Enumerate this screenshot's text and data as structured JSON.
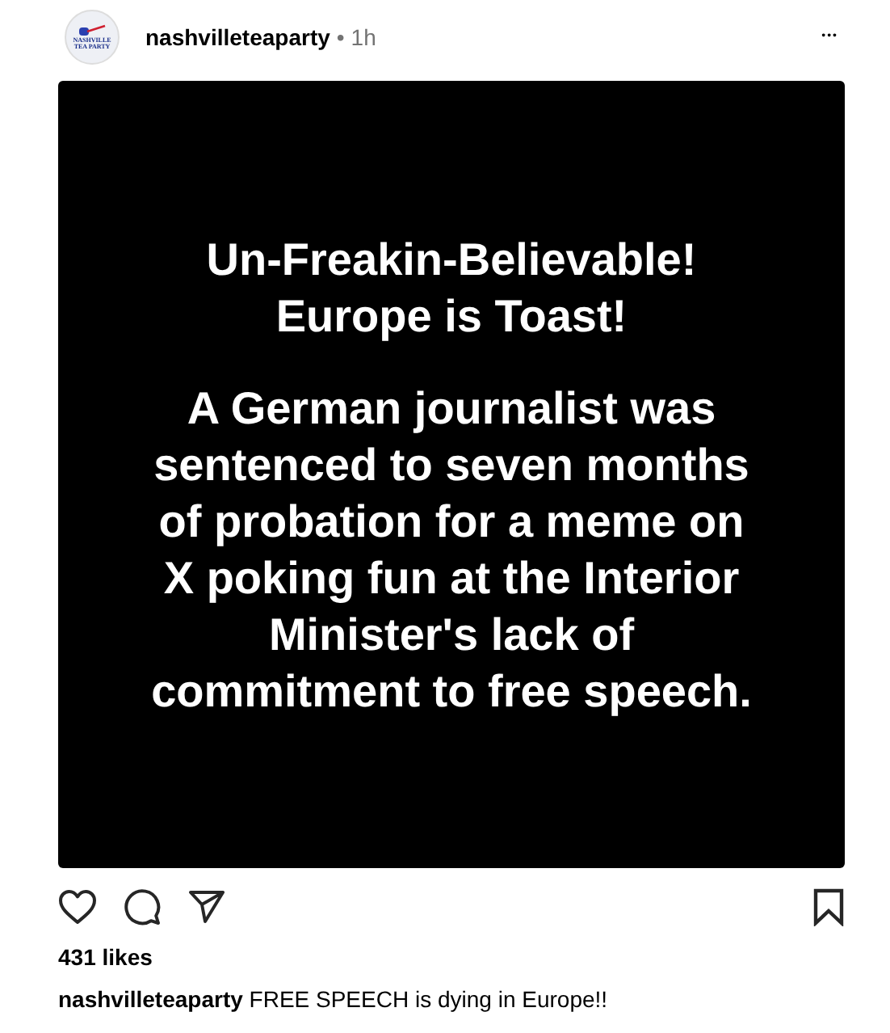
{
  "post": {
    "avatar_text": [
      "NASHVILLE",
      "TEA PARTY"
    ],
    "username": "nashvilleteaparty",
    "separator": "•",
    "time": "1h",
    "more": "•••",
    "image": {
      "headline": [
        "Un-Freakin-Believable!",
        "Europe is Toast!"
      ],
      "body": "A German journalist was sentenced to seven months of probation for a meme on X poking fun at the Interior Minister's lack of commitment to free speech."
    },
    "liked": false,
    "saved": false,
    "likes": "431 likes",
    "caption": {
      "username": "nashvilleteaparty",
      "text": "FREE SPEECH is dying in Europe!!"
    }
  }
}
